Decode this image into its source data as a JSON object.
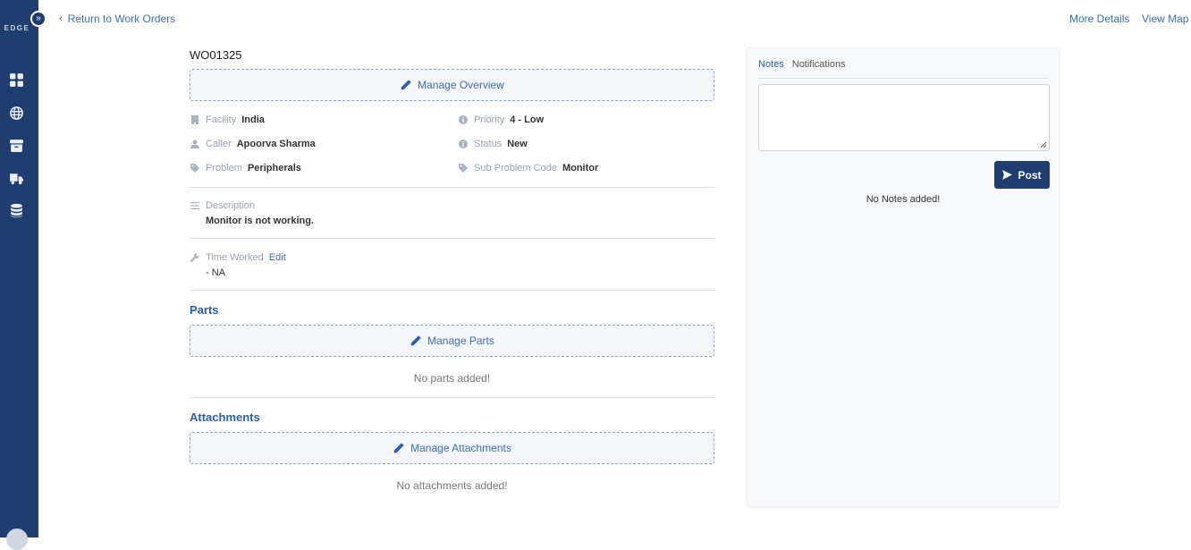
{
  "sidebar": {
    "brand": "EDGE",
    "expand_label": "»",
    "items": [
      {
        "icon": "dashboard-icon"
      },
      {
        "icon": "globe-icon"
      },
      {
        "icon": "archive-icon"
      },
      {
        "icon": "truck-icon"
      },
      {
        "icon": "database-icon"
      }
    ]
  },
  "topbar": {
    "back_label": "Return to Work Orders",
    "more_details": "More Details",
    "view_map": "View Map"
  },
  "work_order": {
    "id": "WO01325",
    "manage_overview": "Manage Overview",
    "fields": {
      "facility_label": "Facility",
      "facility_value": "India",
      "priority_label": "Priority",
      "priority_value": "4 - Low",
      "caller_label": "Caller",
      "caller_value": "Apoorva Sharma",
      "status_label": "Status",
      "status_value": "New",
      "problem_label": "Problem",
      "problem_value": "Peripherals",
      "subproblem_label": "Sub Problem Code",
      "subproblem_value": "Monitor"
    },
    "description_label": "Description",
    "description_value": "Monitor is not working.",
    "time_worked_label": "Time Worked",
    "time_worked_edit": "Edit",
    "time_worked_value": "- NA"
  },
  "parts": {
    "title": "Parts",
    "manage_label": "Manage Parts",
    "empty": "No parts added!"
  },
  "attachments": {
    "title": "Attachments",
    "manage_label": "Manage Attachments",
    "empty": "No attachments added!"
  },
  "panel": {
    "tabs": [
      "Notes",
      "Notifications"
    ],
    "active_tab": "Notes",
    "post_label": "Post",
    "empty": "No Notes added!"
  },
  "colors": {
    "sidebar": "#1f3d6e",
    "accent": "#2c5ea8",
    "link": "#3d6db5"
  }
}
